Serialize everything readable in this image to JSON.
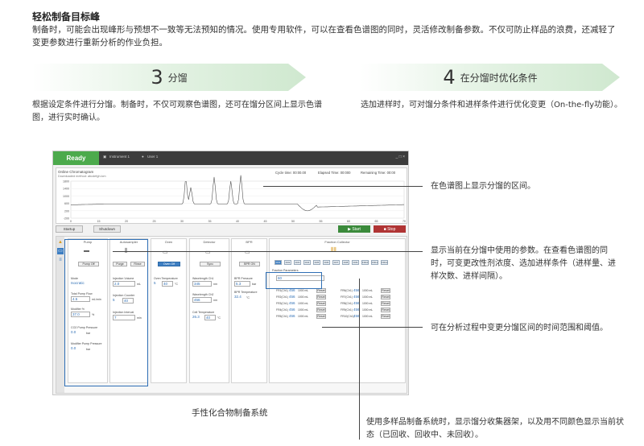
{
  "heading": "轻松制备目标峰",
  "intro": "制备时，可能会出现峰形与预想不一致等无法预知的情况。使用专用软件，可以在查看色谱图的同时，灵活修改制备参数。不仅可防止样品的浪费，还减轻了变更参数进行重新分析的作业负担。",
  "steps": [
    {
      "num": "3",
      "label": "分馏",
      "desc": "根据设定条件进行分馏。制备时，不仅可观察色谱图，还可在馏分区间上显示色谱图，进行实时确认。"
    },
    {
      "num": "4",
      "label": "在分馏时优化条件",
      "desc": "选加进样时，可对馏分条件和进样条件进行优化变更（On-the-fly功能）。"
    }
  ],
  "screenshot": {
    "status": "Ready",
    "instrument_tab": "Instrument 1",
    "user_tab": "User 1",
    "window_controls": "_ □ ×",
    "chrom_title": "Online Chromatogram",
    "chrom_sub": "Downloaded method: abcdefgh.lcm",
    "cycle_time": "Cycle time: 00:00.00",
    "elapsed_time": "Elapsed Time: 00:000",
    "remaining_time": "Remaining Time: 00:00",
    "y_ticks": [
      "1800",
      "1400",
      "1000",
      "600",
      "200",
      "-200"
    ],
    "x_ticks": [
      "0",
      "15",
      "20",
      "25",
      "30",
      "35",
      "40",
      "45",
      "50",
      "55",
      "60",
      "65",
      "70"
    ],
    "startup_label": "Startup",
    "shutdown_label": "Shutdown",
    "start_label": "Start",
    "stop_label": "Stop",
    "modules": {
      "pump": {
        "title": "Pump",
        "btn": "Pump Off",
        "mode_label": "Mode",
        "mode_val": "Isocratic",
        "total_flow_label": "Total Pump Flow",
        "total_flow_val": "4.5",
        "total_flow_unit": "mL/min",
        "modifier_label": "Modifier %",
        "modifier_val": "37.0",
        "modifier_unit": "%",
        "co2_label": "CO2 Pump Pressure",
        "co2_val": "0.0",
        "co2_unit": "bar",
        "mod_press_label": "Modifier Pump Pressure",
        "mod_press_val": "0.0",
        "mod_press_unit": "bar"
      },
      "autosampler": {
        "title": "Autosampler",
        "btn1": "Purge",
        "btn2": "Rinse",
        "inj_vol_label": "Injection Volume",
        "inj_vol_val": "2.0",
        "inj_vol_unit": "mL",
        "inj_count_label": "Injection Counter",
        "inj_count_val": "5",
        "inj_count_max": "40",
        "inj_interval_label": "Injection Interval",
        "inj_interval_val": "7",
        "inj_interval_unit": "min"
      },
      "oven": {
        "title": "Oven",
        "btn": "Oven Off",
        "temp_label": "Oven Temperature",
        "temp_val": "5",
        "temp_set": "40",
        "temp_unit": "°C"
      },
      "detector": {
        "title": "Detector",
        "btn": "Sync",
        "wl1_label": "Wavelength Ch1",
        "wl1_val": "345",
        "wl1_unit": "nm",
        "wl2_label": "Wavelength Ch2",
        "wl2_val": "456",
        "wl2_unit": "nm",
        "cell_label": "Cell Temperature",
        "cell_val": "26.3",
        "cell_set": "40",
        "cell_unit": "°C"
      },
      "bpr": {
        "title": "BPR",
        "btn": "BPR ON",
        "pressure_label": "BPR Pressure",
        "pressure_val": "5.3",
        "pressure_unit": "bar",
        "temp_label": "BPR Temperature",
        "temp_val": "32.4",
        "temp_unit": "°C"
      },
      "fraction": {
        "title": "Fraction Collector",
        "buttons": [
          "FR1",
          "FR2",
          "FR3",
          "FR4",
          "FR5",
          "FR6",
          "FR7",
          "FR8",
          "FR9",
          "FR10",
          "FR11",
          "FR12"
        ],
        "thresh_label": "Fraction Parameters",
        "thresh_val": "60",
        "rows_left": [
          "FR1(Ch1)",
          "FR2(Ch1)",
          "FR3(Ch1)",
          "FR4(Ch1)",
          "FR5(Ch1)"
        ],
        "rows_right": [
          "FR6(Ch1)",
          "FR7(Ch1)",
          "FR8(Ch1)",
          "FR9(Ch1)",
          "FR10(Ch1)"
        ],
        "row_val": "456",
        "row_unit": "1000 mL",
        "reset": "Reset"
      }
    }
  },
  "callouts": [
    "在色谱图上显示分馏的区间。",
    "显示当前在分馏中使用的参数。在查看色谱图的同时，可变更改性剂浓度、选加进样条件（进样量、进样次数、进样间隔）。",
    "可在分析过程中变更分馏区间的时间范围和阈值。",
    "使用多样品制备系统时，显示馏分收集器架，以及用不同颜色显示当前状态（已回收、回收中、未回收）。"
  ],
  "caption": "手性化合物制备系统",
  "colors": {
    "arrow": "#e6f3e6",
    "ready": "#4caa4c",
    "start": "#3b8a3b",
    "stop": "#b03434",
    "highlight": "#2f6fb5",
    "value": "#2f6fb5"
  }
}
